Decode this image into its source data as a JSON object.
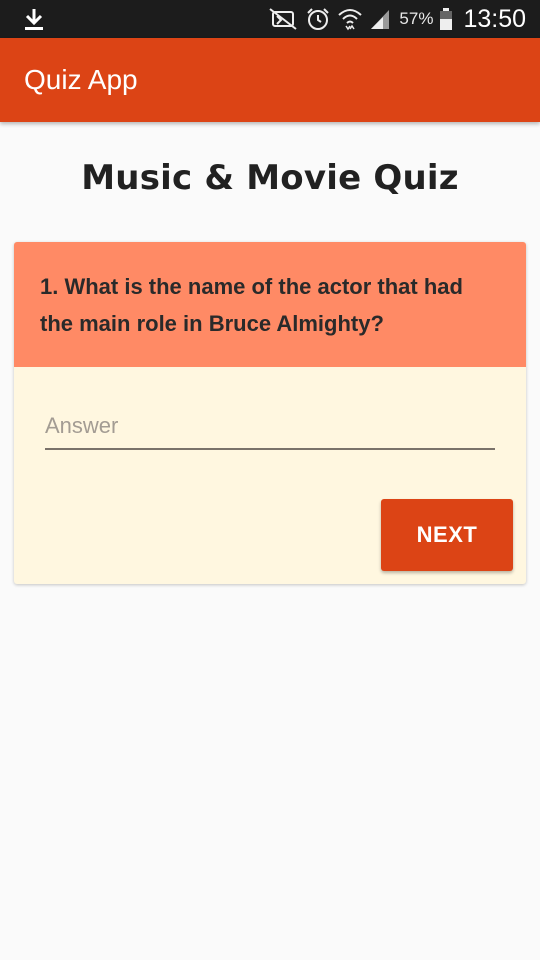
{
  "status_bar": {
    "battery_percent": "57%",
    "time": "13:50",
    "icons": [
      "download-icon",
      "nfc-mute-icon",
      "alarm-icon",
      "wifi-icon",
      "signal-icon",
      "battery-icon"
    ]
  },
  "app_bar": {
    "title": "Quiz App",
    "color": "#dc4415"
  },
  "page": {
    "title": "Music & Movie Quiz"
  },
  "question": {
    "text": "1. What is the name of the actor that had the main role in Bruce Almighty?",
    "background": "#ff8a65"
  },
  "answer": {
    "placeholder": "Answer",
    "value": ""
  },
  "actions": {
    "next_label": "NEXT"
  },
  "colors": {
    "accent": "#dc4415",
    "card_background": "#fff7e0",
    "page_background": "#fafafa"
  }
}
